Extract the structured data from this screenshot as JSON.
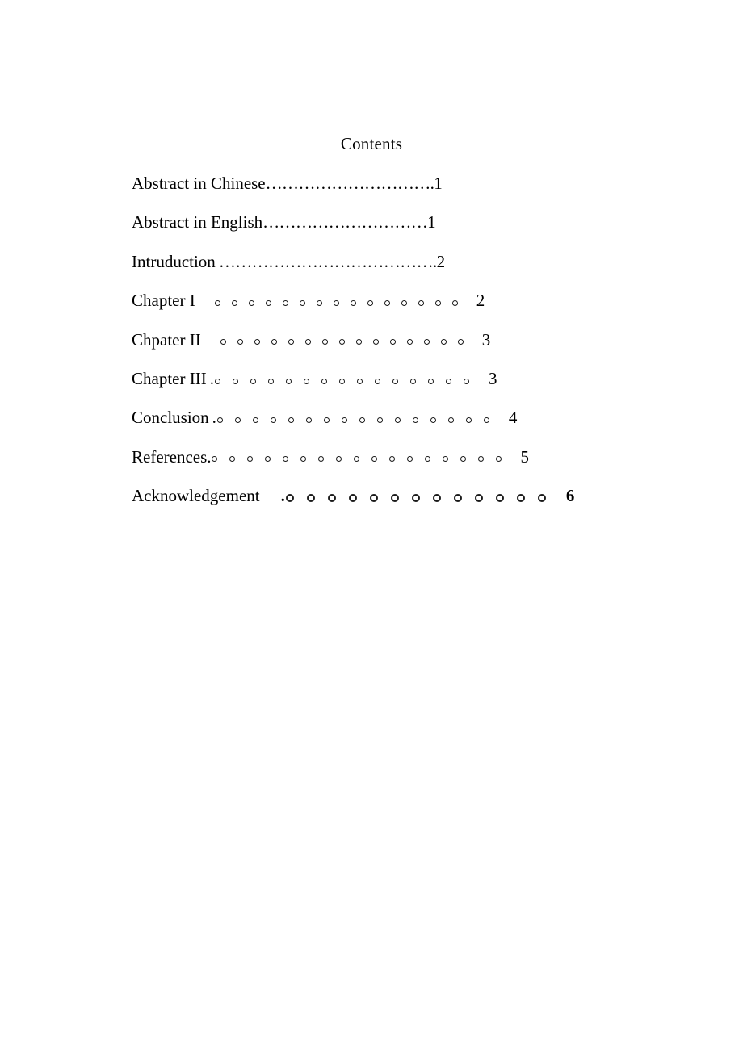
{
  "document": {
    "title": "Contents",
    "page_background": "#ffffff",
    "text_color": "#000000"
  },
  "toc": {
    "heading": "Contents",
    "entries": [
      {
        "label": "Abstract in Chinese",
        "leader_style": "ellipsis",
        "leader": "………………………….",
        "page": "1"
      },
      {
        "label": "Abstract in English",
        "leader_style": "ellipsis",
        "leader": "…………………………",
        "page": "1"
      },
      {
        "label": "Intruduction",
        "leader_style": "ellipsis",
        "leader": "………………………………….",
        "page": "2"
      },
      {
        "label": "Chapter I",
        "leader_style": "circles",
        "leader_lead_dot": "",
        "leader_circle_count": 15,
        "leader_circle_size": 5,
        "leader_circle_gap": 19,
        "page": "2"
      },
      {
        "label": "Chpater II",
        "leader_style": "circles",
        "leader_lead_dot": "",
        "leader_circle_count": 15,
        "leader_circle_size": 5,
        "leader_circle_gap": 19,
        "page": "3"
      },
      {
        "label": "Chapter III",
        "leader_style": "circles",
        "leader_lead_dot": ".",
        "leader_circle_count": 15,
        "leader_circle_size": 5,
        "leader_circle_gap": 20,
        "page": "3"
      },
      {
        "label": "Conclusion",
        "leader_style": "circles",
        "leader_lead_dot": ".",
        "leader_circle_count": 16,
        "leader_circle_size": 5,
        "leader_circle_gap": 20,
        "page": "4"
      },
      {
        "label": "References.",
        "leader_style": "circles",
        "leader_lead_dot": "",
        "leader_circle_count": 17,
        "leader_circle_size": 5,
        "leader_circle_gap": 20,
        "page": "5"
      },
      {
        "label": "Acknowledgement",
        "leader_style": "circles",
        "leader_lead_dot": ".",
        "leader_circle_count": 13,
        "leader_circle_size": 6,
        "leader_circle_gap": 22,
        "page": "6"
      }
    ]
  }
}
